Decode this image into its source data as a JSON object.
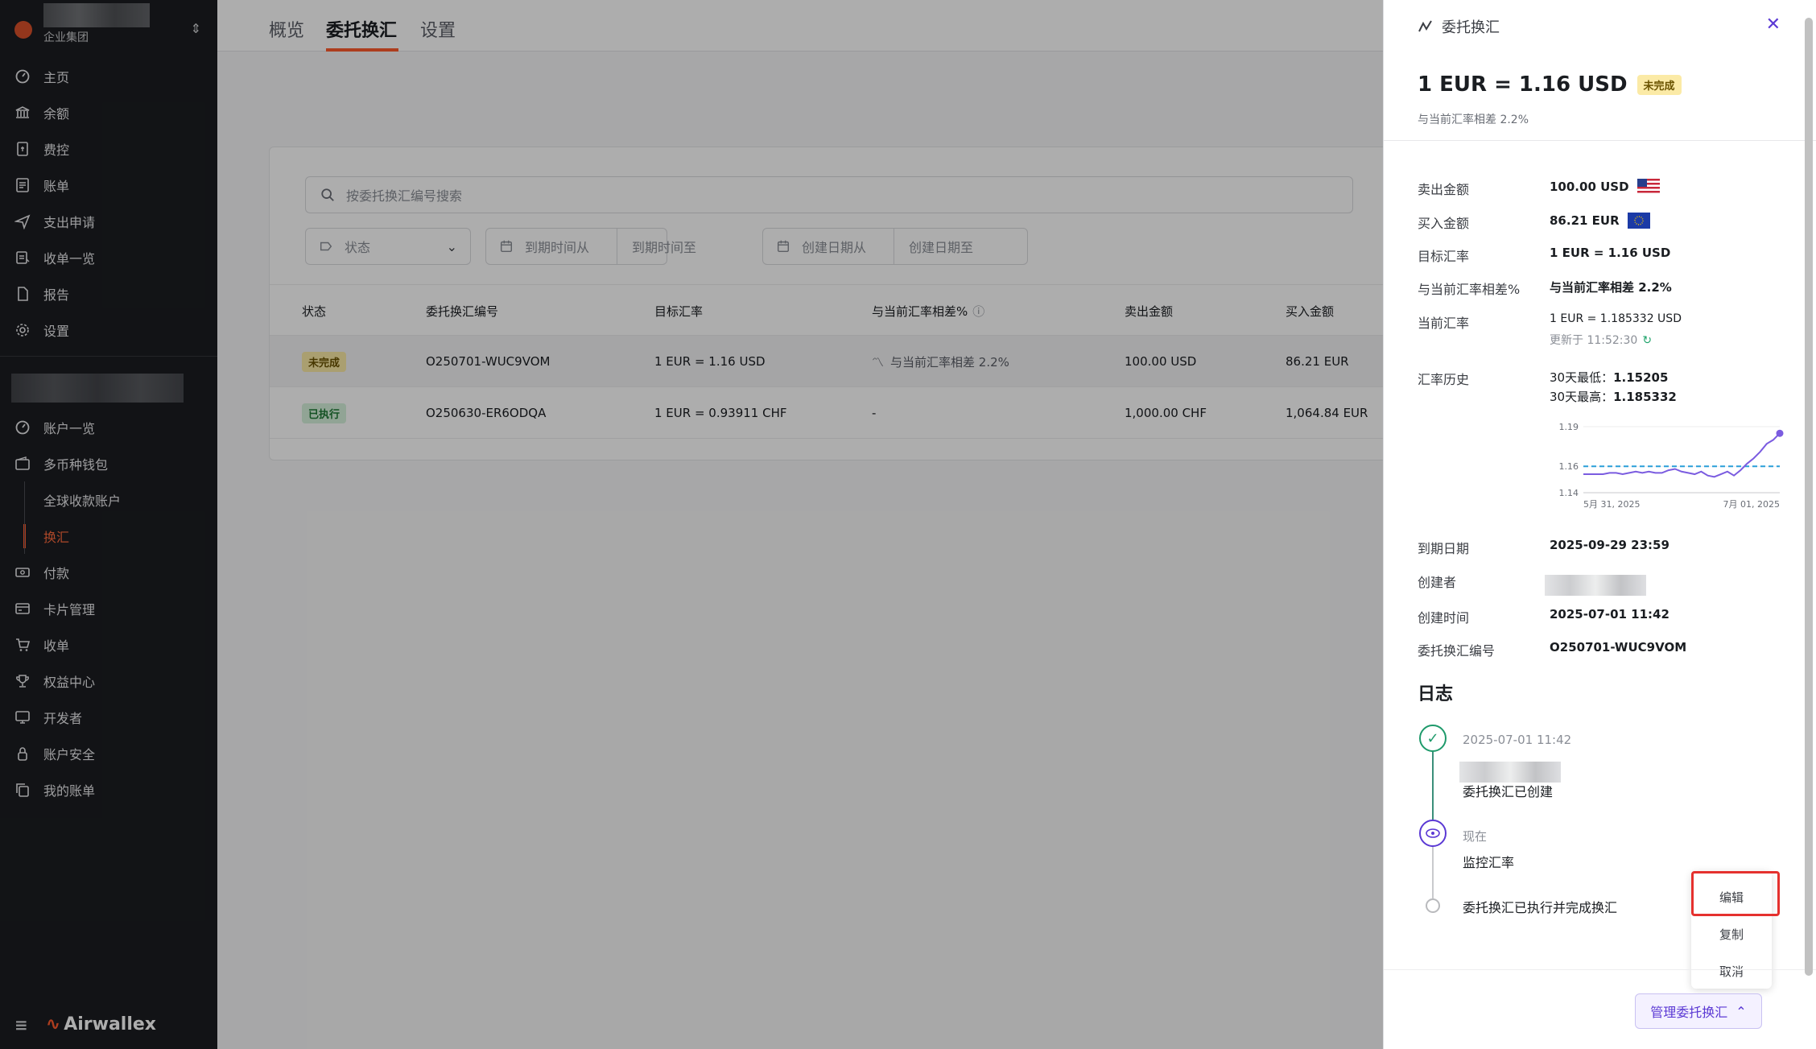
{
  "sidebar": {
    "org_subtitle": "企业集团",
    "items": [
      {
        "label": "主页",
        "icon": "dashboard-icon"
      },
      {
        "label": "余额",
        "icon": "bank-icon"
      },
      {
        "label": "费控",
        "icon": "receipt-icon"
      },
      {
        "label": "账单",
        "icon": "bill-icon"
      },
      {
        "label": "支出申请",
        "icon": "send-icon"
      },
      {
        "label": "收单一览",
        "icon": "collection-icon"
      },
      {
        "label": "报告",
        "icon": "report-icon"
      },
      {
        "label": "设置",
        "icon": "gear-icon"
      }
    ],
    "items2": [
      {
        "label": "账户一览",
        "icon": "dashboard-icon"
      },
      {
        "label": "多币种钱包",
        "icon": "wallet-icon"
      },
      {
        "label": "全球收款账户",
        "icon": ""
      },
      {
        "label": "换汇",
        "icon": ""
      },
      {
        "label": "付款",
        "icon": "payment-icon"
      },
      {
        "label": "卡片管理",
        "icon": "card-icon"
      },
      {
        "label": "收单",
        "icon": "cart-icon"
      },
      {
        "label": "权益中心",
        "icon": "trophy-icon"
      },
      {
        "label": "开发者",
        "icon": "monitor-icon"
      },
      {
        "label": "账户安全",
        "icon": "lock-icon"
      },
      {
        "label": "我的账单",
        "icon": "copy-icon"
      }
    ],
    "brand": "Airwallex"
  },
  "tabs": [
    "概览",
    "委托换汇",
    "设置"
  ],
  "search": {
    "placeholder": "按委托换汇编号搜索"
  },
  "filters": {
    "status": "状态",
    "expiry_from": "到期时间从",
    "expiry_to": "到期时间至",
    "created_from": "创建日期从",
    "created_to": "创建日期至"
  },
  "table": {
    "headers": [
      "状态",
      "委托换汇编号",
      "目标汇率",
      "与当前汇率相差%",
      "卖出金额",
      "买入金额"
    ],
    "rows": [
      {
        "status": "未完成",
        "status_type": "pending",
        "id": "O250701-WUC9VOM",
        "target": "1 EUR = 1.16 USD",
        "diff": "与当前汇率相差 2.2%",
        "sell": "100.00 USD",
        "buy": "86.21 EUR"
      },
      {
        "status": "已执行",
        "status_type": "done",
        "id": "O250630-ER6ODQA",
        "target": "1 EUR = 0.93911 CHF",
        "diff": "-",
        "sell": "1,000.00 CHF",
        "buy": "1,064.84 EUR"
      }
    ]
  },
  "panel": {
    "title": "委托换汇",
    "rate": "1 EUR = 1.16 USD",
    "badge": "未完成",
    "diff": "与当前汇率相差 2.2%",
    "fields": {
      "sell_label": "卖出金额",
      "sell_value": "100.00 USD",
      "buy_label": "买入金额",
      "buy_value": "86.21 EUR",
      "target_label": "目标汇率",
      "target_value": "1 EUR = 1.16 USD",
      "diff_label": "与当前汇率相差%",
      "diff_value": "与当前汇率相差 2.2%",
      "current_label": "当前汇率",
      "current_value": "1 EUR = 1.185332 USD",
      "updated": "更新于 11:52:30",
      "history_label": "汇率历史",
      "low": "30天最低：",
      "low_value": "1.15205",
      "high": "30天最高：",
      "high_value": "1.185332",
      "expiry_label": "到期日期",
      "expiry_value": "2025-09-29 23:59",
      "creator_label": "创建者",
      "created_label": "创建时间",
      "created_value": "2025-07-01 11:42",
      "id_label": "委托换汇编号",
      "id_value": "O250701-WUC9VOM"
    },
    "log_title": "日志",
    "log": [
      {
        "time": "2025-07-01 11:42",
        "text": "委托换汇已创建"
      },
      {
        "time": "现在",
        "text": "监控汇率"
      },
      {
        "time": "",
        "text": "委托换汇已执行并完成换汇"
      }
    ],
    "menu": [
      "编辑",
      "复制",
      "取消"
    ],
    "manage": "管理委托换汇"
  },
  "chart_data": {
    "type": "line",
    "x": [
      "5月 31, 2025",
      "",
      "",
      "",
      "",
      "",
      "",
      "",
      "",
      "",
      "",
      "",
      "",
      "",
      "",
      "",
      "",
      "",
      "",
      "",
      "",
      "",
      "",
      "",
      "",
      "",
      "",
      "",
      "",
      "",
      "7月 01, 2025"
    ],
    "values": [
      1.154,
      1.154,
      1.154,
      1.154,
      1.155,
      1.155,
      1.154,
      1.155,
      1.156,
      1.155,
      1.156,
      1.155,
      1.155,
      1.157,
      1.158,
      1.156,
      1.155,
      1.154,
      1.156,
      1.153,
      1.152,
      1.154,
      1.156,
      1.153,
      1.157,
      1.162,
      1.166,
      1.171,
      1.177,
      1.18,
      1.185
    ],
    "reference": 1.16,
    "yticks": [
      "1.19",
      "1.16",
      "1.14"
    ],
    "ylim": [
      1.14,
      1.19
    ],
    "line_color": "#7b5ce0",
    "ref_color": "#2a9fd8"
  }
}
